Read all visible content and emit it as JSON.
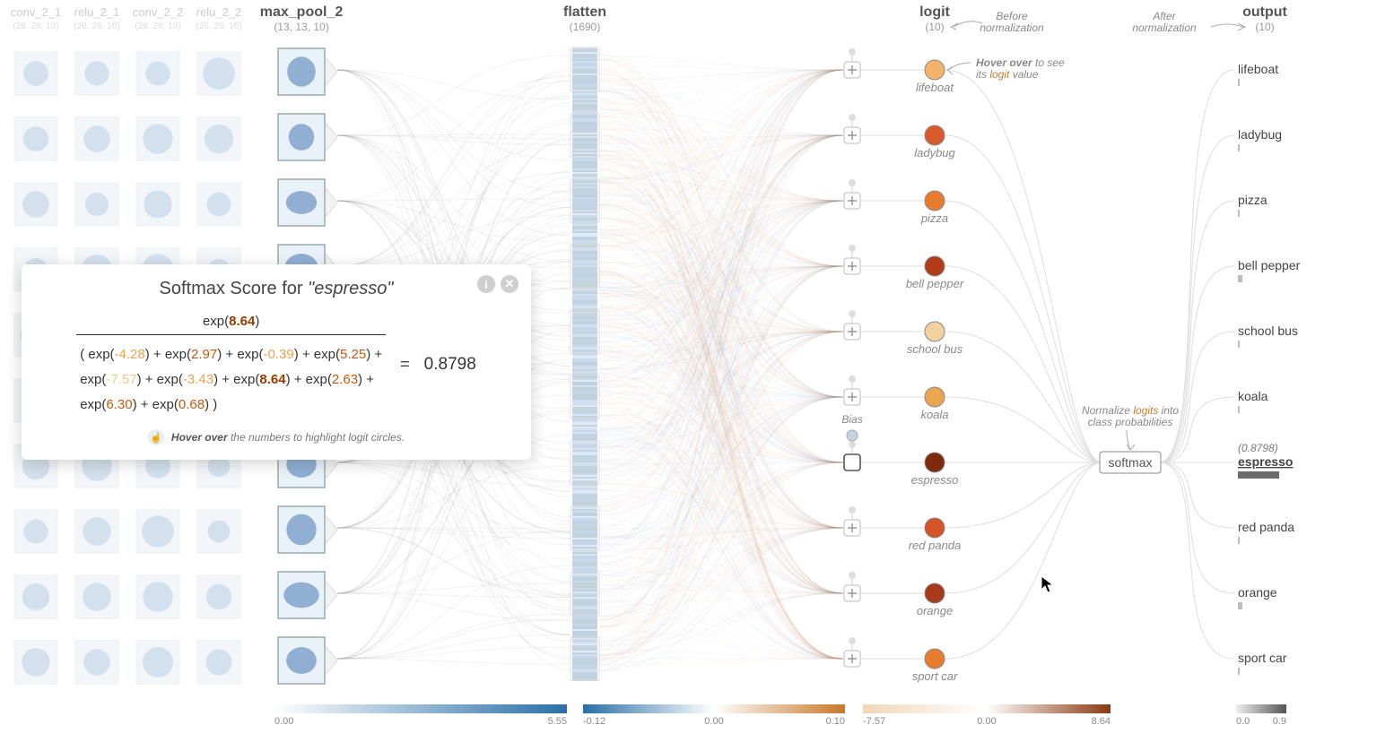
{
  "faded_layers": [
    {
      "name": "conv_2_1",
      "shape": "(28, 28, 10)"
    },
    {
      "name": "relu_2_1",
      "shape": "(28, 28, 10)"
    },
    {
      "name": "conv_2_2",
      "shape": "(28, 28, 10)"
    },
    {
      "name": "relu_2_2",
      "shape": "(26, 26, 10)"
    }
  ],
  "layers": {
    "maxpool": {
      "title": "max_pool_2",
      "shape": "(13, 13, 10)"
    },
    "flatten": {
      "title": "flatten",
      "shape": "(1690)"
    },
    "logit": {
      "title": "logit",
      "shape": "(10)"
    },
    "output": {
      "title": "output",
      "shape": "(10)"
    }
  },
  "annotations": {
    "before": "Before\nnormalization",
    "after": "After\nnormalization",
    "hover_logit": "Hover over to see\nits logit value",
    "hover_logit_word": "logit",
    "normalize": "Normalize logits into\nclass probabilities",
    "normalize_word": "logits",
    "bias": "Bias",
    "softmax": "softmax"
  },
  "classes": [
    {
      "name": "lifeboat",
      "color": "#f3b36a"
    },
    {
      "name": "ladybug",
      "color": "#d9592c"
    },
    {
      "name": "pizza",
      "color": "#e77c2e"
    },
    {
      "name": "bell pepper",
      "color": "#b23c18"
    },
    {
      "name": "school bus",
      "color": "#f2d0a0"
    },
    {
      "name": "koala",
      "color": "#eda650"
    },
    {
      "name": "espresso",
      "color": "#7e2a0e",
      "selected": true,
      "prob": "(0.8798)"
    },
    {
      "name": "red panda",
      "color": "#d25427"
    },
    {
      "name": "orange",
      "color": "#a73a18"
    },
    {
      "name": "sport car",
      "color": "#e77c2e"
    }
  ],
  "softmax_popup": {
    "title_prefix": "Softmax Score for ",
    "class": "\"espresso\"",
    "top": "8.64",
    "result": "0.8798",
    "denominator": [
      {
        "v": "-4.28",
        "c": "v-neg"
      },
      {
        "v": "2.97",
        "c": "v-pos"
      },
      {
        "v": "-0.39",
        "c": "v-neg"
      },
      {
        "v": "5.25",
        "c": "v-pos"
      },
      {
        "v": "-7.57",
        "c": "v-neg2"
      },
      {
        "v": "-3.43",
        "c": "v-neg"
      },
      {
        "v": "8.64",
        "c": "v-top"
      },
      {
        "v": "2.63",
        "c": "v-pos"
      },
      {
        "v": "6.30",
        "c": "v-pos"
      },
      {
        "v": "0.68",
        "c": "v-pos"
      }
    ],
    "hint_bold": "Hover over",
    "hint_rest": " the numbers to highlight logit circles."
  },
  "scales": {
    "maxpool": {
      "min": "0.00",
      "max": "5.55"
    },
    "flatten": {
      "min": "-0.12",
      "mid": "0.00",
      "max": "0.10"
    },
    "logit": {
      "min": "-7.57",
      "mid": "0.00",
      "max": "8.64"
    },
    "output": {
      "min": "0.0",
      "max": "0.9"
    }
  },
  "chart_data": {
    "type": "table",
    "title": "CNN output head visualization (flatten → logit → softmax)",
    "logits": {
      "lifeboat": -4.28,
      "ladybug": 2.97,
      "pizza": -0.39,
      "bell pepper": 5.25,
      "school bus": -7.57,
      "koala": -3.43,
      "espresso": 8.64,
      "red panda": 2.63,
      "orange": 6.3,
      "sport car": 0.68
    },
    "softmax_probabilities": {
      "espresso": 0.8798
    },
    "logit_range": [
      -7.57,
      8.64
    ],
    "output_range": [
      0.0,
      0.9
    ],
    "maxpool_activation_range": [
      0.0,
      5.55
    ],
    "flatten_weight_range": [
      -0.12,
      0.1
    ]
  }
}
